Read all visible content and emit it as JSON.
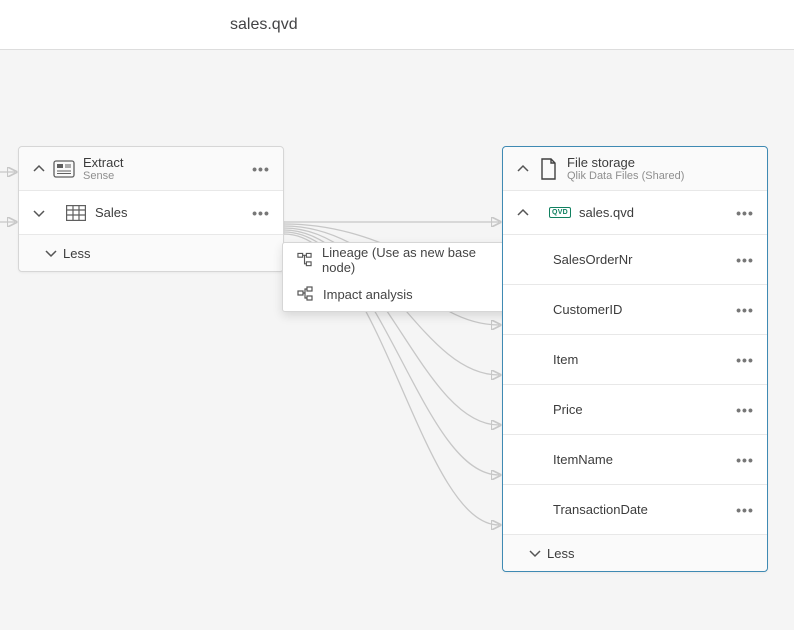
{
  "header": {
    "title": "sales.qvd"
  },
  "left_card": {
    "title": "Extract",
    "subtitle": "Sense",
    "child_label": "Sales",
    "less_label": "Less"
  },
  "right_card": {
    "title": "File storage",
    "subtitle": "Qlik Data Files (Shared)",
    "child_label": "sales.qvd",
    "less_label": "Less",
    "fields": [
      {
        "label": "SalesOrderNr"
      },
      {
        "label": "CustomerID"
      },
      {
        "label": "Item"
      },
      {
        "label": "Price"
      },
      {
        "label": "ItemName"
      },
      {
        "label": "TransactionDate"
      }
    ]
  },
  "context_menu": {
    "lineage_label": "Lineage (Use as new base node)",
    "impact_label": "Impact analysis"
  },
  "icons": {
    "qvd_badge": "QVD"
  }
}
